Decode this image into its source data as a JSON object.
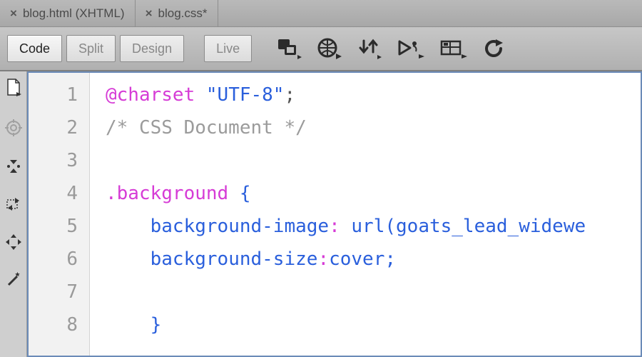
{
  "tabs": [
    {
      "label": "blog.html (XHTML)"
    },
    {
      "label": "blog.css*"
    }
  ],
  "toolbar": {
    "views": {
      "code": "Code",
      "split": "Split",
      "design": "Design",
      "live": "Live"
    }
  },
  "icons": {
    "file_mgmt": "file-management-icon",
    "preview": "preview-browser-icon",
    "download": "download-upload-icon",
    "play": "live-view-icon",
    "inspect": "inspect-icon",
    "refresh": "refresh-icon"
  },
  "gutter_tools": {
    "new_doc": "new-doc-icon",
    "target": "target-icon",
    "collapse": "collapse-icon",
    "select": "select-icon",
    "move": "move-icon",
    "wand": "wand-icon"
  },
  "code": {
    "line_numbers": [
      "1",
      "2",
      "3",
      "4",
      "5",
      "6",
      "7",
      "8"
    ],
    "l1": {
      "atrule": "@charset",
      "sp": " ",
      "string": "\"UTF-8\"",
      "semi": ";"
    },
    "l2": {
      "comment": "/* CSS Document */"
    },
    "l4": {
      "selector": ".background",
      "sp": " ",
      "brace": "{"
    },
    "l5": {
      "indent": "    ",
      "prop": "background-image",
      "colon": ":",
      "sp": " ",
      "fn": "url(",
      "arg": "goats_lead_widewe"
    },
    "l6": {
      "indent": "    ",
      "prop": "background-size",
      "colon": ":",
      "value": "cover",
      "semi": ";"
    },
    "l8": {
      "indent": "    ",
      "brace": "}"
    }
  }
}
